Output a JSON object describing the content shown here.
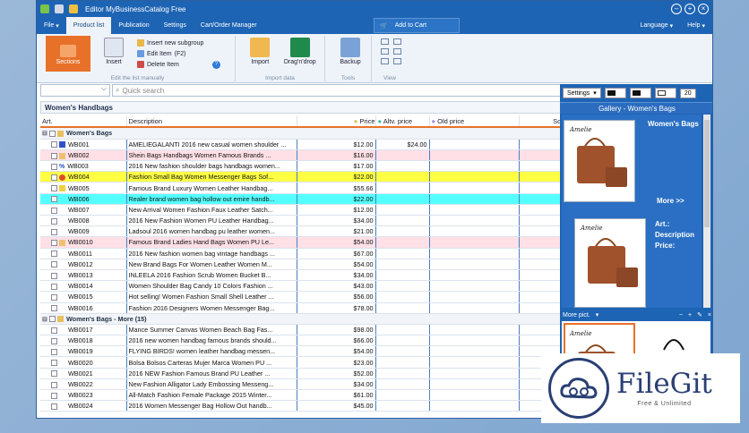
{
  "window": {
    "title": "Editor MyBusinessCatalog Free"
  },
  "menu": {
    "items": [
      "File",
      "Product list",
      "Publication",
      "Settings",
      "Cart/Order Manager"
    ],
    "active_index": 1,
    "add_to_cart": "Add to Cart",
    "right": [
      "Language",
      "Help"
    ]
  },
  "ribbon": {
    "sections_label": "Sections",
    "insert_label": "Insert",
    "insert_subgroup": "Insert new subgroup",
    "edit_item": "Edit Item",
    "edit_item_shortcut": "(F2)",
    "delete_item": "Delete Item",
    "edit_group_label": "Edit the list manually",
    "import_label": "Import",
    "dragdrop_label": "Drag'n'drop",
    "import_group_label": "Import data",
    "backup_label": "Backup",
    "tools_group_label": "Tools",
    "view_group_label": "View"
  },
  "search": {
    "placeholder": "Quick search"
  },
  "group_header": "Women's Handbags",
  "columns": [
    "Art.",
    "Description",
    "Price",
    "Altv. price",
    "Old price",
    "Some field"
  ],
  "groups": [
    {
      "name": "Women's Bags",
      "rows": [
        {
          "art": "WB001",
          "desc": "AMELIEGALANTI 2016 new casual women shoulder ...",
          "price": "$12.00",
          "altv": "$24.00",
          "color": "#ffffff",
          "tag": "flag"
        },
        {
          "art": "WB002",
          "desc": "Shein Bags Handbags Women Famous Brands ...",
          "price": "$16.00",
          "altv": "",
          "color": "#ffe0e6",
          "tag": "note"
        },
        {
          "art": "WB003",
          "desc": "2016 New fashion shoulder bags handbags women...",
          "price": "$17.00",
          "altv": "",
          "color": "#ffffff",
          "tag": "percent"
        },
        {
          "art": "WB004",
          "desc": "Fashion Small Bag Women Messenger Bags Sof...",
          "price": "$22.00",
          "altv": "",
          "color": "#ffff44",
          "tag": "star"
        },
        {
          "art": "WB005",
          "desc": "Famous Brand Luxury Women Leather Handbag...",
          "price": "$55.66",
          "altv": "",
          "color": "#ffffff",
          "tag": "warn"
        },
        {
          "art": "WB006",
          "desc": "Realer brand women bag hollow out emire handb...",
          "price": "$22.00",
          "altv": "",
          "color": "#55ffff",
          "tag": ""
        },
        {
          "art": "WB007",
          "desc": "New Arrival Women Fashion Faux Leather Satch...",
          "price": "$12.00",
          "altv": "",
          "color": "#ffffff",
          "tag": ""
        },
        {
          "art": "WB008",
          "desc": "2016 New Fashion Women PU Leather Handbag...",
          "price": "$34.00",
          "altv": "",
          "color": "#ffffff",
          "tag": ""
        },
        {
          "art": "WB009",
          "desc": "Ladsoul 2016 women handbag pu leather women...",
          "price": "$21.00",
          "altv": "",
          "color": "#ffffff",
          "tag": ""
        },
        {
          "art": "WB0010",
          "desc": "Famous Brand Ladies Hand Bags Women PU Le...",
          "price": "$54.00",
          "altv": "",
          "color": "#ffe0e6",
          "tag": "note"
        },
        {
          "art": "WB0011",
          "desc": "2016 New fashion women bag vintage handbags ...",
          "price": "$67.00",
          "altv": "",
          "color": "#ffffff",
          "tag": ""
        },
        {
          "art": "WB0012",
          "desc": "New Brand Bags For Women Leather Women M...",
          "price": "$54.00",
          "altv": "",
          "color": "#ffffff",
          "tag": ""
        },
        {
          "art": "WB0013",
          "desc": "INLEELA 2016 Fashion Scrub Women Bucket B...",
          "price": "$34.00",
          "altv": "",
          "color": "#ffffff",
          "tag": ""
        },
        {
          "art": "WB0014",
          "desc": "Women Shoulder Bag Candy 10 Colors Fashion ...",
          "price": "$43.00",
          "altv": "",
          "color": "#ffffff",
          "tag": ""
        },
        {
          "art": "WB0015",
          "desc": "Hot selling! Women Fashion Small Shell Leather ...",
          "price": "$56.00",
          "altv": "",
          "color": "#ffffff",
          "tag": ""
        },
        {
          "art": "WB0016",
          "desc": "Fashion 2016 Designers Women Messenger Bag...",
          "price": "$78.00",
          "altv": "",
          "color": "#ffffff",
          "tag": ""
        }
      ]
    },
    {
      "name": "Women's Bags - More",
      "count": "(15)",
      "rows": [
        {
          "art": "WB0017",
          "desc": "Mance Summer Canvas Women Beach Bag Fas...",
          "price": "$98.00",
          "altv": "",
          "color": "#ffffff",
          "tag": ""
        },
        {
          "art": "WB0018",
          "desc": "2016 new women handbag famous brands should...",
          "price": "$66.00",
          "altv": "",
          "color": "#ffffff",
          "tag": ""
        },
        {
          "art": "WB0019",
          "desc": "FLYING BIRDS! women leather handbag messen...",
          "price": "$54.00",
          "altv": "",
          "color": "#ffffff",
          "tag": ""
        },
        {
          "art": "WB0020",
          "desc": "Bolsa Bolsos Carteras Mujer Marca Women PU ...",
          "price": "$23.00",
          "altv": "",
          "color": "#ffffff",
          "tag": ""
        },
        {
          "art": "WB0021",
          "desc": "2016 NEW Fashion Famous Brand PU Leather ...",
          "price": "$52.00",
          "altv": "",
          "color": "#ffffff",
          "tag": ""
        },
        {
          "art": "WB0022",
          "desc": "New Fashion Alligator Lady Embossing Messeng...",
          "price": "$34.00",
          "altv": "",
          "color": "#ffffff",
          "tag": ""
        },
        {
          "art": "WB0023",
          "desc": "All-Match Fashion Female Package 2015 Winter...",
          "price": "$61.00",
          "altv": "",
          "color": "#ffffff",
          "tag": ""
        },
        {
          "art": "WB0024",
          "desc": "2016 Women Messenger Bag Hollow Out handb...",
          "price": "$45.00",
          "altv": "",
          "color": "#ffffff",
          "tag": ""
        }
      ]
    }
  ],
  "right_panel": {
    "settings_label": "Settings",
    "font_size": "20",
    "gallery_title": "Gallery - Women's Bags",
    "card_title": "Women's Bags",
    "more_label": "More >>",
    "art_label": "Art.:",
    "description_label": "Description",
    "price_label": "Price:",
    "add_to_cart": "Add to Cart",
    "more_pict": "More pict.",
    "card_brand": "Amelie"
  },
  "watermark": {
    "brand": "FileGit",
    "tagline": "Free & Unlimited"
  },
  "colors": {
    "accent": "#1e64b4",
    "orange": "#e8712a",
    "yellow_row": "#ffff44",
    "cyan_row": "#55ffff",
    "pink_row": "#ffe0e6"
  }
}
